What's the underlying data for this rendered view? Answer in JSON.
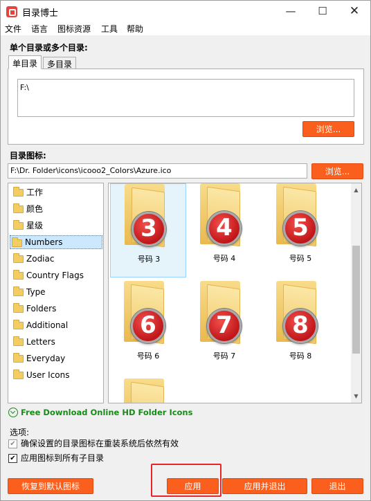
{
  "window": {
    "title": "目录博士"
  },
  "menu": [
    "文件",
    "语言",
    "图标资源",
    "工具",
    "帮助"
  ],
  "dirs_section": {
    "label": "单个目录或多个目录:",
    "tabs": [
      "单目录",
      "多目录"
    ],
    "path_value": "F:\\",
    "browse_label": "浏览..."
  },
  "icon_section": {
    "label": "目录图标:",
    "path_value": "F:\\Dr. Folder\\icons\\icooo2_Colors\\Azure.ico",
    "browse_label": "浏览..."
  },
  "tree": [
    "工作",
    "颜色",
    "星级",
    "Numbers",
    "Zodiac",
    "Country Flags",
    "Type",
    "Folders",
    "Additional",
    "Letters",
    "Everyday",
    "User Icons"
  ],
  "tree_selected": "Numbers",
  "icons": [
    {
      "number": "3",
      "label": "号码 3"
    },
    {
      "number": "4",
      "label": "号码 4"
    },
    {
      "number": "5",
      "label": "号码 5"
    },
    {
      "number": "6",
      "label": "号码 6"
    },
    {
      "number": "7",
      "label": "号码 7"
    },
    {
      "number": "8",
      "label": "号码 8"
    }
  ],
  "download_link": "Free Download Online HD Folder Icons",
  "options": {
    "label": "选项:",
    "opt1": "确保设置的目录图标在重装系统后依然有效",
    "opt2": "应用图标到所有子目录"
  },
  "buttons": {
    "restore": "恢复到默认图标",
    "apply": "应用",
    "apply_exit": "应用并退出",
    "exit": "退出"
  },
  "colors": {
    "accent": "#fb5f1d",
    "link": "#1a8a1a",
    "highlight": "#e8242a"
  }
}
